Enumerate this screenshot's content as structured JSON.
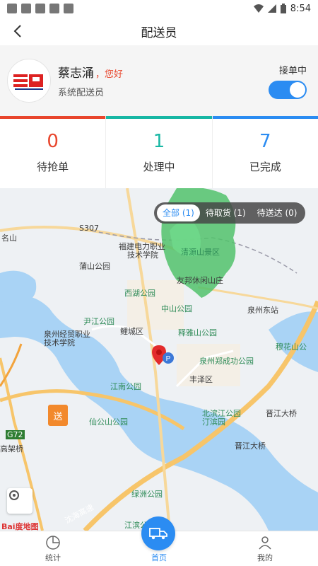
{
  "status_bar": {
    "time": "8:54"
  },
  "nav": {
    "title": "配送员"
  },
  "profile": {
    "name": "蔡志涌",
    "greeting": "，您好",
    "role": "系统配送员",
    "accept_label": "接单中",
    "accept_on": true
  },
  "stats": [
    {
      "value": "0",
      "label": "待抢单",
      "color": "#e8452c"
    },
    {
      "value": "1",
      "label": "处理中",
      "color": "#18b7a4"
    },
    {
      "value": "7",
      "label": "已完成",
      "color": "#2b8cf2"
    }
  ],
  "map": {
    "filters": [
      {
        "label": "全部 (1)",
        "active": true
      },
      {
        "label": "待取货 (1)",
        "active": false
      },
      {
        "label": "待送达 (0)",
        "active": false
      }
    ],
    "labels": {
      "fujian": "福建电力职业",
      "fujian2": "技术学院",
      "qingyuan": "清源山景区",
      "youbang": "友邦休闲山庄",
      "xihu": "西湖公园",
      "zhongshan": "中山公园",
      "quanzhoudong": "泉州东站",
      "licheng": "鲤城区",
      "shifeng": "释雅山公园",
      "jingmao": "泉州经贸职业",
      "jingmao2": "技术学院",
      "zhanghu": "泉州郑成功公园",
      "fengze": "丰泽区",
      "jiangnan": "江南公园",
      "xiangshan": "仙公山公园",
      "beibin": "北滨江公园",
      "dinghu": "汀滨园",
      "jinjiang": "晋江大桥",
      "jinjiang2": "晋江大桥",
      "gaojia": "高架桥",
      "lvzhou": "绿洲公园",
      "jiangbin": "江滨公园",
      "shanming": "名山",
      "puhe": "蒲山公园",
      "muhua": "穆花山公",
      "yunshan": "尹江公园",
      "g72": "G72",
      "s307": "S307",
      "send": "送",
      "shenhai": "沈海高速",
      "baidu": "Bai度地图"
    }
  },
  "bottom_nav": [
    {
      "label": "统计",
      "active": false
    },
    {
      "label": "首页",
      "active": true
    },
    {
      "label": "我的",
      "active": false
    }
  ]
}
